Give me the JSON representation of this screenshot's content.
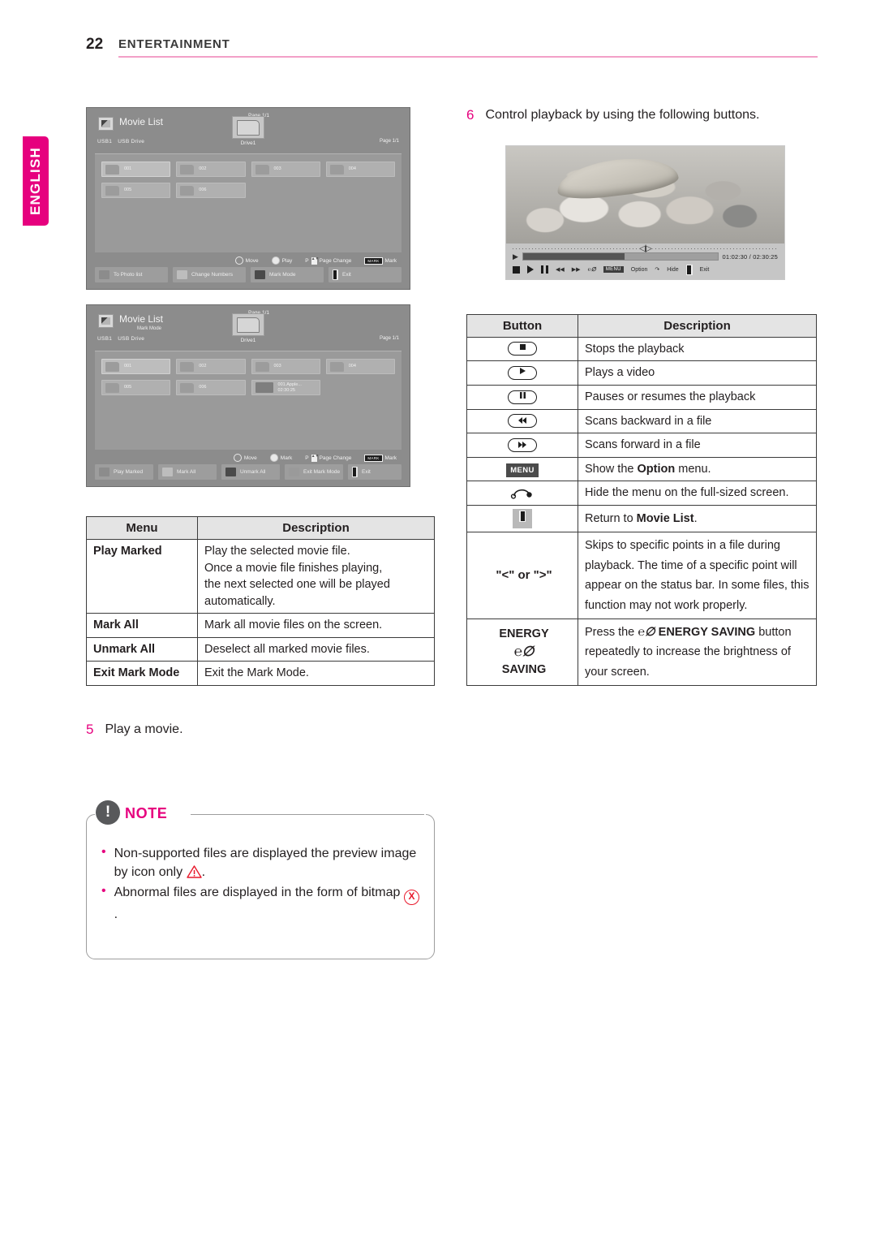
{
  "page": {
    "number": "22",
    "title": "ENTERTAINMENT",
    "language_tab": "ENGLISH"
  },
  "screenshot_browse": {
    "title": "Movie List",
    "usb_label": "USB1",
    "usb_drive": "USB Drive",
    "drive_caption": "Drive1",
    "page_top": "Page 1/1",
    "page_right": "Page 1/1",
    "files": [
      "001",
      "002",
      "003",
      "004",
      "005",
      "006"
    ],
    "hints": [
      {
        "icon": "dpad-icon",
        "label": "Move"
      },
      {
        "icon": "ok-button-icon",
        "label": "Play"
      },
      {
        "icon": "page-updown-icon",
        "label": "Page Change"
      },
      {
        "icon": "mark-key-icon",
        "label": "Mark"
      }
    ],
    "hint_p_prefix": "P",
    "mark_key_label": "MARK",
    "buttons": [
      "To Photo list",
      "Change Numbers",
      "Mark Mode",
      "Exit"
    ]
  },
  "screenshot_markmode": {
    "title": "Movie List",
    "subtitle": "Mark Mode",
    "usb_label": "USB1",
    "usb_drive": "USB Drive",
    "drive_caption": "Drive1",
    "page_top": "Page 1/1",
    "page_right": "Page 1/1",
    "files": [
      "001",
      "002",
      "003",
      "004",
      "005",
      "006"
    ],
    "marked_file": {
      "name": "001.Apple...",
      "duration": "02:30:25"
    },
    "hints": [
      {
        "icon": "dpad-icon",
        "label": "Move"
      },
      {
        "icon": "ok-button-icon",
        "label": "Mark"
      },
      {
        "icon": "page-updown-icon",
        "label": "Page Change"
      },
      {
        "icon": "mark-key-icon",
        "label": "Mark"
      }
    ],
    "hint_p_prefix": "P",
    "mark_key_label": "MARK",
    "buttons": [
      "Play Marked",
      "Mark All",
      "Unmark All",
      "Exit Mark Mode",
      "Exit"
    ]
  },
  "menu_table": {
    "headers": [
      "Menu",
      "Description"
    ],
    "rows": [
      {
        "menu": "Play Marked",
        "description": "Play the selected movie file.\nOnce a movie file finishes playing,\nthe next selected one will be played\nautomatically."
      },
      {
        "menu": "Mark All",
        "description": "Mark all movie files on the screen."
      },
      {
        "menu": "Unmark All",
        "description": "Deselect all marked movie files."
      },
      {
        "menu": "Exit Mark Mode",
        "description": "Exit the Mark Mode."
      }
    ]
  },
  "step5": {
    "number": "5",
    "text": "Play a movie."
  },
  "step6": {
    "number": "6",
    "text": "Control playback by using the following buttons."
  },
  "note": {
    "label": "NOTE",
    "badge": "!",
    "bullets": [
      {
        "text_before": "Non-supported files are displayed the preview image by icon only",
        "icon": "warning-triangle-icon",
        "text_after": "."
      },
      {
        "text_before": "Abnormal files are displayed in the form of bitmap",
        "icon": "bitmap-x-icon",
        "text_after": "."
      }
    ]
  },
  "player": {
    "time": "01:02:30 / 02:30:25",
    "option_label": "Option",
    "menu_label": "MENU",
    "hide_label": "Hide",
    "exit_label": "Exit",
    "progress_percent": "52"
  },
  "button_table": {
    "headers": [
      "Button",
      "Description"
    ],
    "rows": [
      {
        "icon": "stop-button-icon",
        "key": "",
        "description": "Stops the playback"
      },
      {
        "icon": "play-button-icon",
        "key": "",
        "description": "Plays a video"
      },
      {
        "icon": "pause-button-icon",
        "key": "",
        "description": "Pauses or resumes the playback"
      },
      {
        "icon": "rewind-button-icon",
        "key": "",
        "description": "Scans backward in a file"
      },
      {
        "icon": "fastforward-button-icon",
        "key": "",
        "description": "Scans forward in a file"
      },
      {
        "icon": "menu-key-icon",
        "key": "MENU",
        "description": "Show the Option menu.",
        "bold_word": "Option"
      },
      {
        "icon": "hide-menu-icon",
        "key": "",
        "description": "Hide the menu on the full-sized screen."
      },
      {
        "icon": "exit-key-icon",
        "key": "",
        "description": "Return to Movie List.",
        "bold_word": "Movie List"
      },
      {
        "icon": "arrow-keys-icon",
        "key": "\"<\" or \">\"",
        "description": "Skips to specific points in a file during playback. The time of a specific point will appear on the status bar. In some files, this function may not work properly."
      },
      {
        "icon": "energy-saving-icon",
        "key": "ENERGY SAVING",
        "key_line1": "ENERGY",
        "key_line2": "SAVING",
        "description": "Press the ENERGY SAVING button repeatedly to increase the brightness of your screen."
      }
    ]
  },
  "colors": {
    "accent": "#e6007e",
    "rule": "#f2a0c8",
    "note_badge": "#58595b",
    "table_header": "#e4e4e4",
    "red_icon": "#e8192c"
  }
}
